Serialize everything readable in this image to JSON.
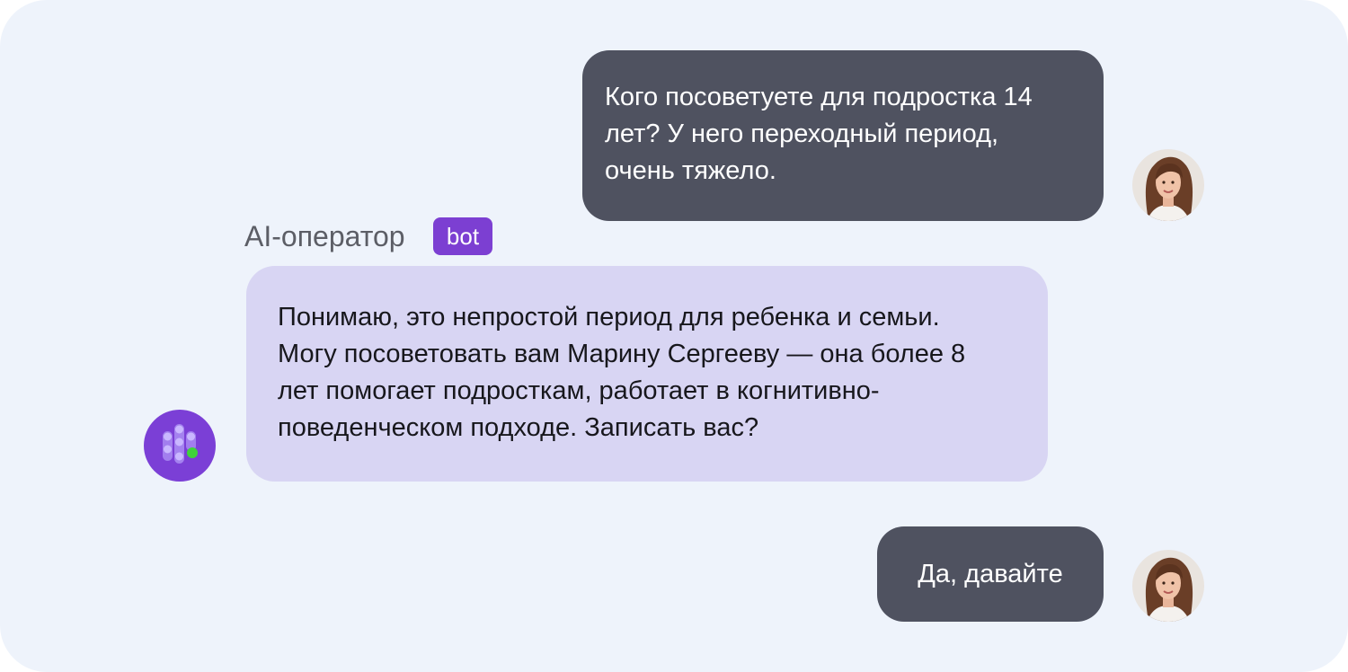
{
  "chat": {
    "messages": [
      {
        "role": "user",
        "lines": [
          "Кого посоветуете для подростка 14",
          "лет? У него переходный период,",
          "очень тяжело."
        ]
      },
      {
        "role": "bot",
        "lines": [
          "Понимаю, это непростой период для ребенка и семьи.",
          "Могу посоветовать вам Марину Сергееву — она более 8",
          "лет помогает подросткам, работает в когнитивно-",
          "поведенческом подходе. Записать вас?"
        ]
      },
      {
        "role": "user",
        "lines": [
          "Да, давайте"
        ]
      }
    ],
    "bot_sender": {
      "name": "AI-оператор",
      "badge": "bot"
    },
    "icons": {
      "user_avatar": "user-photo-avatar",
      "bot_avatar": "ai-operator-logo-icon"
    },
    "colors": {
      "background": "#eef3fb",
      "user_bubble": "#4f5260",
      "bot_bubble": "#d8d5f3",
      "accent": "#7c3fd2",
      "online_indicator": "#3fd33b"
    }
  }
}
